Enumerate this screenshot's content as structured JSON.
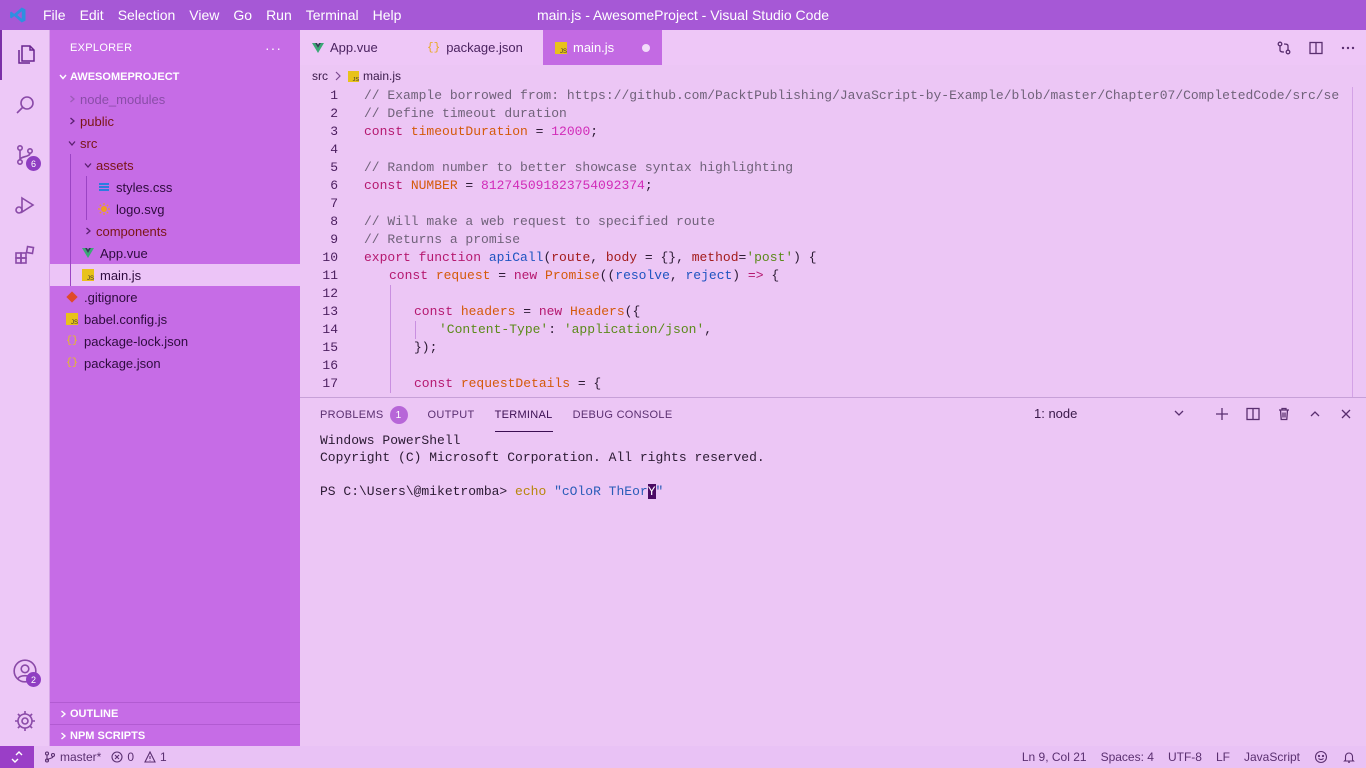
{
  "app": {
    "window_title": "main.js - AwesomeProject - Visual Studio Code",
    "menu": [
      "File",
      "Edit",
      "Selection",
      "View",
      "Go",
      "Run",
      "Terminal",
      "Help"
    ]
  },
  "activity_bar": {
    "source_control_badge": "6",
    "accounts_badge": "2"
  },
  "sidebar": {
    "title": "EXPLORER",
    "more_actions": "···",
    "project": "AWESOMEPROJECT",
    "tree": [
      {
        "label": "node_modules",
        "type": "folder"
      },
      {
        "label": "public",
        "type": "folder"
      },
      {
        "label": "src",
        "type": "folder"
      },
      {
        "label": "assets",
        "type": "folder"
      },
      {
        "label": "styles.css",
        "type": "file"
      },
      {
        "label": "logo.svg",
        "type": "file"
      },
      {
        "label": "components",
        "type": "folder"
      },
      {
        "label": "App.vue",
        "type": "file"
      },
      {
        "label": "main.js",
        "type": "file"
      },
      {
        "label": ".gitignore",
        "type": "file"
      },
      {
        "label": "babel.config.js",
        "type": "file"
      },
      {
        "label": "package-lock.json",
        "type": "file"
      },
      {
        "label": "package.json",
        "type": "file"
      }
    ],
    "outline": "OUTLINE",
    "npm_scripts": "NPM SCRIPTS"
  },
  "editor": {
    "tabs": [
      {
        "label": "App.vue"
      },
      {
        "label": "package.json"
      },
      {
        "label": "main.js"
      }
    ],
    "breadcrumb": [
      "src",
      "main.js"
    ],
    "line_numbers": [
      "1",
      "2",
      "3",
      "4",
      "5",
      "6",
      "7",
      "8",
      "9",
      "10",
      "11",
      "12",
      "13",
      "14",
      "15",
      "16",
      "17"
    ]
  },
  "code_text": {
    "l1": "// Example borrowed from: https://github.com/PacktPublishing/JavaScript-by-Example/blob/master/Chapter07/CompletedCode/src/se",
    "l2": "// Define timeout duration",
    "l3_kw": "const ",
    "l3_var": "timeoutDuration",
    "l3_eq": " = ",
    "l3_num": "12000",
    "l3_end": ";",
    "l5": "// Random number to better showcase syntax highlighting",
    "l6_kw": "const ",
    "l6_var": "NUMBER",
    "l6_eq": " = ",
    "l6_num": "812745091823754092374",
    "l6_end": ";",
    "l8": "// Will make a web request to specified route",
    "l9": "// Returns a promise",
    "l10_kw": "export function ",
    "l10_fn": "apiCall",
    "l10_p1": "(",
    "l10_a1": "route",
    "l10_p2": ", ",
    "l10_a2": "body",
    "l10_p3": " = {}, ",
    "l10_a3": "method",
    "l10_p4": "=",
    "l10_s": "'post'",
    "l10_p5": ") {",
    "l11_kw": "const ",
    "l11_var": "request",
    "l11_eq": " = ",
    "l11_new": "new ",
    "l11_cls": "Promise",
    "l11_p1": "((",
    "l11_a1": "resolve",
    "l11_p2": ", ",
    "l11_a2": "reject",
    "l11_p3": ") ",
    "l11_arrow": "=>",
    "l11_p4": " {",
    "l13_kw": "const ",
    "l13_var": "headers",
    "l13_eq": " = ",
    "l13_new": "new ",
    "l13_cls": "Headers",
    "l13_end": "({",
    "l14_s1": "'Content-Type'",
    "l14_colon": ": ",
    "l14_s2": "'application/json'",
    "l14_end": ",",
    "l15": "});",
    "l17_kw": "const ",
    "l17_var": "requestDetails",
    "l17_end": " = {"
  },
  "panel": {
    "tabs": [
      "PROBLEMS",
      "OUTPUT",
      "TERMINAL",
      "DEBUG CONSOLE"
    ],
    "problems_count": "1",
    "terminal_select": "1: node",
    "terminal": {
      "line1": "Windows PowerShell",
      "line2": "Copyright (C) Microsoft Corporation. All rights reserved.",
      "prompt": "PS C:\\Users\\@miketromba> ",
      "cmd": "echo",
      "arg_main": " \"cOloR ThEor",
      "arg_cursor": "Y",
      "arg_end": "\""
    }
  },
  "statusbar": {
    "branch": "master*",
    "errors": "0",
    "warnings": "1",
    "position": "Ln 9, Col 21",
    "spaces": "Spaces: 4",
    "encoding": "UTF-8",
    "eol": "LF",
    "language": "JavaScript"
  },
  "colors": {
    "titlebar": "#a658d6",
    "sidebar": "#c66ce6",
    "editor_bg": "#ecc6f5",
    "accent": "#8f3ec2"
  }
}
